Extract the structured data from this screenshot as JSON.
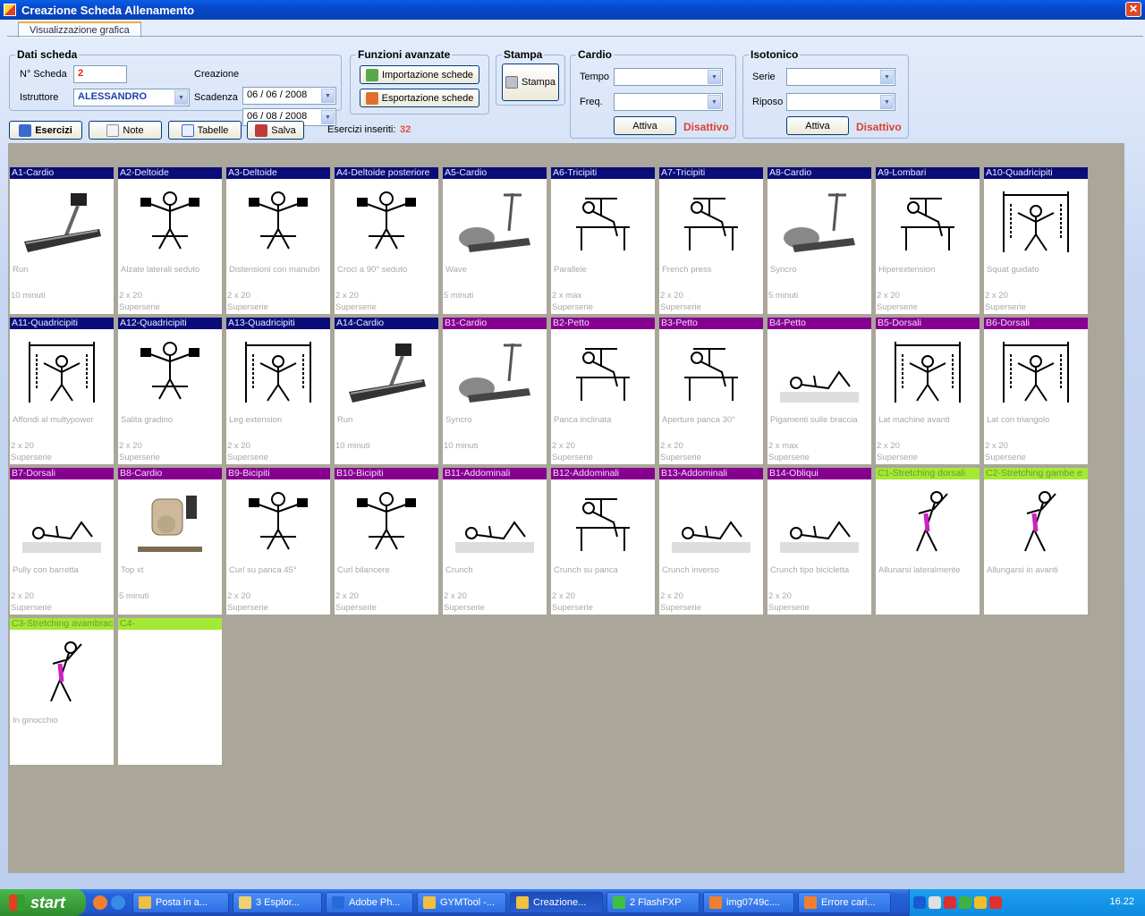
{
  "window": {
    "title": "Creazione Scheda Allenamento"
  },
  "tabs": [
    {
      "label": "Visualizzazione grafica"
    }
  ],
  "dati_scheda": {
    "legend": "Dati scheda",
    "n_scheda_label": "N° Scheda",
    "n_scheda_value": "2",
    "istruttore_label": "Istruttore",
    "istruttore_value": "ALESSANDRO",
    "creazione_label": "Creazione",
    "creazione_value": "06 / 06 / 2008",
    "scadenza_label": "Scadenza",
    "scadenza_value": "06 / 08 / 2008"
  },
  "funzioni": {
    "legend": "Funzioni avanzate",
    "import_label": "Importazione schede",
    "export_label": "Esportazione schede"
  },
  "stampa": {
    "legend": "Stampa",
    "button_label": "Stampa"
  },
  "cardio": {
    "legend": "Cardio",
    "tempo_label": "Tempo",
    "freq_label": "Freq.",
    "attiva_label": "Attiva",
    "status": "Disattivo"
  },
  "isotonico": {
    "legend": "Isotonico",
    "serie_label": "Serie",
    "riposo_label": "Riposo",
    "attiva_label": "Attiva",
    "status": "Disattivo"
  },
  "toolbar": {
    "esercizi": "Esercizi",
    "note": "Note",
    "tabelle": "Tabelle",
    "salva": "Salva",
    "inseriti_label": "Esercizi inseriti:",
    "inseriti_count": "32"
  },
  "exercises": [
    {
      "head": "A1-Cardio",
      "name": "Run",
      "line1": "10 minuti",
      "line2": "",
      "group": "A",
      "pic": "treadmill"
    },
    {
      "head": "A2-Deltoide",
      "name": "Alzate laterali seduto",
      "line1": "2 x 20",
      "line2": "Superserie",
      "group": "A",
      "pic": "lift"
    },
    {
      "head": "A3-Deltoide",
      "name": "Distensioni con manubri",
      "line1": "2 x 20",
      "line2": "Superserie",
      "group": "A",
      "pic": "lift"
    },
    {
      "head": "A4-Deltoide posteriore",
      "name": "Croci a 90° seduto",
      "line1": "2 x 20",
      "line2": "Superserie",
      "group": "A",
      "pic": "lift"
    },
    {
      "head": "A5-Cardio",
      "name": "Wave",
      "line1": "5 minuti",
      "line2": "",
      "group": "A",
      "pic": "elliptical"
    },
    {
      "head": "A6-Tricipiti",
      "name": "Parallele",
      "line1": "2 x max",
      "line2": "Superserie",
      "group": "A",
      "pic": "bench"
    },
    {
      "head": "A7-Tricipiti",
      "name": "French press",
      "line1": "2 x 20",
      "line2": "Superserie",
      "group": "A",
      "pic": "bench"
    },
    {
      "head": "A8-Cardio",
      "name": "Syncro",
      "line1": "5 minuti",
      "line2": "",
      "group": "A",
      "pic": "elliptical"
    },
    {
      "head": "A9-Lombari",
      "name": "Hiperextension",
      "line1": "2 x 20",
      "line2": "Superserie",
      "group": "A",
      "pic": "bench"
    },
    {
      "head": "A10-Quadricipiti",
      "name": "Squat guidato",
      "line1": "2 x 20",
      "line2": "Superserie",
      "group": "A",
      "pic": "machine"
    },
    {
      "head": "A11-Quadricipiti",
      "name": "Affondi al multypower",
      "line1": "2 x 20",
      "line2": "Superserie",
      "group": "A",
      "pic": "machine"
    },
    {
      "head": "A12-Quadricipiti",
      "name": "Salita gradino",
      "line1": "2 x 20",
      "line2": "Superserie",
      "group": "A",
      "pic": "lift"
    },
    {
      "head": "A13-Quadricipiti",
      "name": "Leg extension",
      "line1": "2 x 20",
      "line2": "Superserie",
      "group": "A",
      "pic": "machine"
    },
    {
      "head": "A14-Cardio",
      "name": "Run",
      "line1": "10 minuti",
      "line2": "",
      "group": "A",
      "pic": "treadmill"
    },
    {
      "head": "B1-Cardio",
      "name": "Syncro",
      "line1": "10 minuti",
      "line2": "",
      "group": "B",
      "pic": "elliptical"
    },
    {
      "head": "B2-Petto",
      "name": "Panca inclinata",
      "line1": "2 x 20",
      "line2": "Superserie",
      "group": "B",
      "pic": "bench"
    },
    {
      "head": "B3-Petto",
      "name": "Aperture panca 30°",
      "line1": "2 x 20",
      "line2": "Superserie",
      "group": "B",
      "pic": "bench"
    },
    {
      "head": "B4-Petto",
      "name": "Pigamenti sulle braccia",
      "line1": "2 x max",
      "line2": "Superserie",
      "group": "B",
      "pic": "floor"
    },
    {
      "head": "B5-Dorsali",
      "name": "Lat machine avanti",
      "line1": "2 x 20",
      "line2": "Superserie",
      "group": "B",
      "pic": "machine"
    },
    {
      "head": "B6-Dorsali",
      "name": "Lat con triangolo",
      "line1": "2 x 20",
      "line2": "Superserie",
      "group": "B",
      "pic": "machine"
    },
    {
      "head": "B7-Dorsali",
      "name": "Pully con barretta",
      "line1": "2 x 20",
      "line2": "Superserie",
      "group": "B",
      "pic": "floor"
    },
    {
      "head": "B8-Cardio",
      "name": "Top xt",
      "line1": "5 minuti",
      "line2": "",
      "group": "B",
      "pic": "bike"
    },
    {
      "head": "B9-Bicipiti",
      "name": "Curl su panca 45°",
      "line1": "2 x 20",
      "line2": "Superserie",
      "group": "B",
      "pic": "lift"
    },
    {
      "head": "B10-Bicipiti",
      "name": "Curl bilancere",
      "line1": "2 x 20",
      "line2": "Superserie",
      "group": "B",
      "pic": "lift"
    },
    {
      "head": "B11-Addominali",
      "name": "Crunch",
      "line1": "2 x 20",
      "line2": "Superserie",
      "group": "B",
      "pic": "floor"
    },
    {
      "head": "B12-Addominali",
      "name": "Crunch su panca",
      "line1": "2 x 20",
      "line2": "Superserie",
      "group": "B",
      "pic": "bench"
    },
    {
      "head": "B13-Addominali",
      "name": "Crunch inverso",
      "line1": "2 x 20",
      "line2": "Superserie",
      "group": "B",
      "pic": "floor"
    },
    {
      "head": "B14-Obliqui",
      "name": "Crunch tipo bicicletta",
      "line1": "2 x 20",
      "line2": "Superserie",
      "group": "B",
      "pic": "floor"
    },
    {
      "head": "C1-Stretching dorsali",
      "name": "Allunarsi lateralmente",
      "line1": "",
      "line2": "",
      "group": "C",
      "pic": "stretch"
    },
    {
      "head": "C2-Stretching gambe e",
      "name": "Allungarsi in avanti",
      "line1": "",
      "line2": "",
      "group": "C",
      "pic": "stretch"
    },
    {
      "head": "C3-Stretching avambrac",
      "name": "In ginocchio",
      "line1": "",
      "line2": "",
      "group": "C",
      "pic": "stretch"
    },
    {
      "head": "C4-",
      "name": "",
      "line1": "",
      "line2": "",
      "group": "C",
      "pic": ""
    }
  ],
  "taskbar": {
    "start_label": "start",
    "items": [
      {
        "label": "Posta in a...",
        "color": "#f0c040"
      },
      {
        "label": "3 Esplor...",
        "color": "#f0d070"
      },
      {
        "label": "Adobe Ph...",
        "color": "#2a6ad8"
      },
      {
        "label": "GYMTool -...",
        "color": "#f0c040"
      },
      {
        "label": "Creazione...",
        "color": "#f0c040"
      },
      {
        "label": "2 FlashFXP",
        "color": "#40c040"
      },
      {
        "label": "img0749c....",
        "color": "#f08030"
      },
      {
        "label": "Errore cari...",
        "color": "#f08030"
      }
    ],
    "clock": "16.22"
  }
}
